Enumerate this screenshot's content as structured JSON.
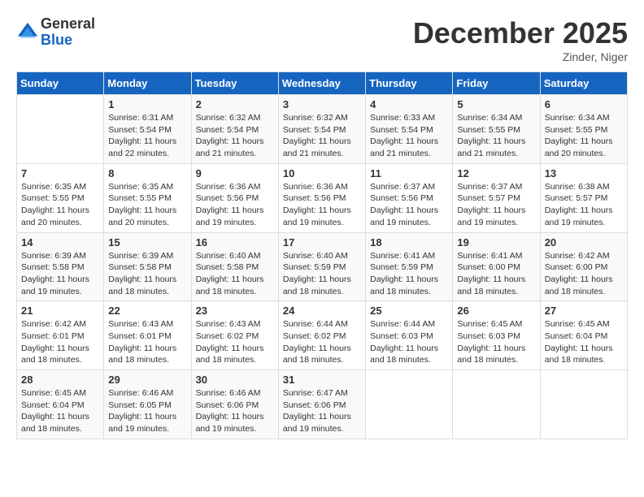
{
  "logo": {
    "general": "General",
    "blue": "Blue"
  },
  "title": "December 2025",
  "location": "Zinder, Niger",
  "days_of_week": [
    "Sunday",
    "Monday",
    "Tuesday",
    "Wednesday",
    "Thursday",
    "Friday",
    "Saturday"
  ],
  "weeks": [
    [
      {
        "day": "",
        "sunrise": "",
        "sunset": "",
        "daylight": ""
      },
      {
        "day": "1",
        "sunrise": "Sunrise: 6:31 AM",
        "sunset": "Sunset: 5:54 PM",
        "daylight": "Daylight: 11 hours and 22 minutes."
      },
      {
        "day": "2",
        "sunrise": "Sunrise: 6:32 AM",
        "sunset": "Sunset: 5:54 PM",
        "daylight": "Daylight: 11 hours and 21 minutes."
      },
      {
        "day": "3",
        "sunrise": "Sunrise: 6:32 AM",
        "sunset": "Sunset: 5:54 PM",
        "daylight": "Daylight: 11 hours and 21 minutes."
      },
      {
        "day": "4",
        "sunrise": "Sunrise: 6:33 AM",
        "sunset": "Sunset: 5:54 PM",
        "daylight": "Daylight: 11 hours and 21 minutes."
      },
      {
        "day": "5",
        "sunrise": "Sunrise: 6:34 AM",
        "sunset": "Sunset: 5:55 PM",
        "daylight": "Daylight: 11 hours and 21 minutes."
      },
      {
        "day": "6",
        "sunrise": "Sunrise: 6:34 AM",
        "sunset": "Sunset: 5:55 PM",
        "daylight": "Daylight: 11 hours and 20 minutes."
      }
    ],
    [
      {
        "day": "7",
        "sunrise": "Sunrise: 6:35 AM",
        "sunset": "Sunset: 5:55 PM",
        "daylight": "Daylight: 11 hours and 20 minutes."
      },
      {
        "day": "8",
        "sunrise": "Sunrise: 6:35 AM",
        "sunset": "Sunset: 5:55 PM",
        "daylight": "Daylight: 11 hours and 20 minutes."
      },
      {
        "day": "9",
        "sunrise": "Sunrise: 6:36 AM",
        "sunset": "Sunset: 5:56 PM",
        "daylight": "Daylight: 11 hours and 19 minutes."
      },
      {
        "day": "10",
        "sunrise": "Sunrise: 6:36 AM",
        "sunset": "Sunset: 5:56 PM",
        "daylight": "Daylight: 11 hours and 19 minutes."
      },
      {
        "day": "11",
        "sunrise": "Sunrise: 6:37 AM",
        "sunset": "Sunset: 5:56 PM",
        "daylight": "Daylight: 11 hours and 19 minutes."
      },
      {
        "day": "12",
        "sunrise": "Sunrise: 6:37 AM",
        "sunset": "Sunset: 5:57 PM",
        "daylight": "Daylight: 11 hours and 19 minutes."
      },
      {
        "day": "13",
        "sunrise": "Sunrise: 6:38 AM",
        "sunset": "Sunset: 5:57 PM",
        "daylight": "Daylight: 11 hours and 19 minutes."
      }
    ],
    [
      {
        "day": "14",
        "sunrise": "Sunrise: 6:39 AM",
        "sunset": "Sunset: 5:58 PM",
        "daylight": "Daylight: 11 hours and 19 minutes."
      },
      {
        "day": "15",
        "sunrise": "Sunrise: 6:39 AM",
        "sunset": "Sunset: 5:58 PM",
        "daylight": "Daylight: 11 hours and 18 minutes."
      },
      {
        "day": "16",
        "sunrise": "Sunrise: 6:40 AM",
        "sunset": "Sunset: 5:58 PM",
        "daylight": "Daylight: 11 hours and 18 minutes."
      },
      {
        "day": "17",
        "sunrise": "Sunrise: 6:40 AM",
        "sunset": "Sunset: 5:59 PM",
        "daylight": "Daylight: 11 hours and 18 minutes."
      },
      {
        "day": "18",
        "sunrise": "Sunrise: 6:41 AM",
        "sunset": "Sunset: 5:59 PM",
        "daylight": "Daylight: 11 hours and 18 minutes."
      },
      {
        "day": "19",
        "sunrise": "Sunrise: 6:41 AM",
        "sunset": "Sunset: 6:00 PM",
        "daylight": "Daylight: 11 hours and 18 minutes."
      },
      {
        "day": "20",
        "sunrise": "Sunrise: 6:42 AM",
        "sunset": "Sunset: 6:00 PM",
        "daylight": "Daylight: 11 hours and 18 minutes."
      }
    ],
    [
      {
        "day": "21",
        "sunrise": "Sunrise: 6:42 AM",
        "sunset": "Sunset: 6:01 PM",
        "daylight": "Daylight: 11 hours and 18 minutes."
      },
      {
        "day": "22",
        "sunrise": "Sunrise: 6:43 AM",
        "sunset": "Sunset: 6:01 PM",
        "daylight": "Daylight: 11 hours and 18 minutes."
      },
      {
        "day": "23",
        "sunrise": "Sunrise: 6:43 AM",
        "sunset": "Sunset: 6:02 PM",
        "daylight": "Daylight: 11 hours and 18 minutes."
      },
      {
        "day": "24",
        "sunrise": "Sunrise: 6:44 AM",
        "sunset": "Sunset: 6:02 PM",
        "daylight": "Daylight: 11 hours and 18 minutes."
      },
      {
        "day": "25",
        "sunrise": "Sunrise: 6:44 AM",
        "sunset": "Sunset: 6:03 PM",
        "daylight": "Daylight: 11 hours and 18 minutes."
      },
      {
        "day": "26",
        "sunrise": "Sunrise: 6:45 AM",
        "sunset": "Sunset: 6:03 PM",
        "daylight": "Daylight: 11 hours and 18 minutes."
      },
      {
        "day": "27",
        "sunrise": "Sunrise: 6:45 AM",
        "sunset": "Sunset: 6:04 PM",
        "daylight": "Daylight: 11 hours and 18 minutes."
      }
    ],
    [
      {
        "day": "28",
        "sunrise": "Sunrise: 6:45 AM",
        "sunset": "Sunset: 6:04 PM",
        "daylight": "Daylight: 11 hours and 18 minutes."
      },
      {
        "day": "29",
        "sunrise": "Sunrise: 6:46 AM",
        "sunset": "Sunset: 6:05 PM",
        "daylight": "Daylight: 11 hours and 19 minutes."
      },
      {
        "day": "30",
        "sunrise": "Sunrise: 6:46 AM",
        "sunset": "Sunset: 6:06 PM",
        "daylight": "Daylight: 11 hours and 19 minutes."
      },
      {
        "day": "31",
        "sunrise": "Sunrise: 6:47 AM",
        "sunset": "Sunset: 6:06 PM",
        "daylight": "Daylight: 11 hours and 19 minutes."
      },
      {
        "day": "",
        "sunrise": "",
        "sunset": "",
        "daylight": ""
      },
      {
        "day": "",
        "sunrise": "",
        "sunset": "",
        "daylight": ""
      },
      {
        "day": "",
        "sunrise": "",
        "sunset": "",
        "daylight": ""
      }
    ]
  ]
}
